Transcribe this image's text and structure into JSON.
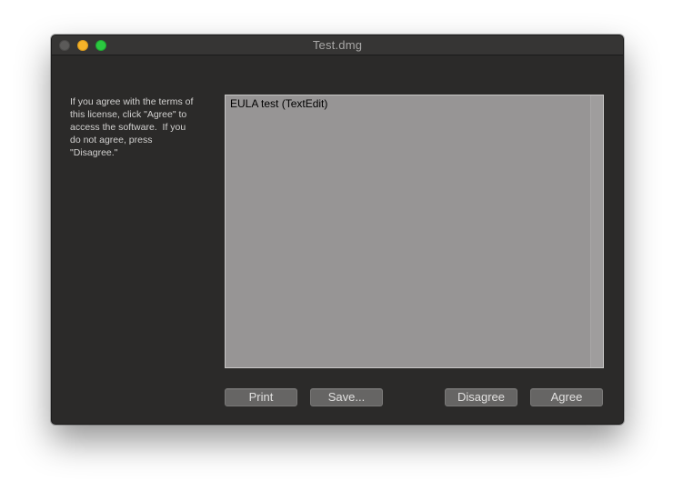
{
  "window": {
    "title": "Test.dmg"
  },
  "instructions": "If you agree with the terms of\nthis license, click \"Agree\" to\naccess the software.  If you\ndo not agree, press\n\"Disagree.\"",
  "license": {
    "text": "EULA test (TextEdit)"
  },
  "buttons": {
    "print": "Print",
    "save": "Save...",
    "disagree": "Disagree",
    "agree": "Agree"
  },
  "colors": {
    "window_background": "#2b2a29",
    "text_area_background": "#979595",
    "button_background": "#666564",
    "close_button": "#5b5a59",
    "minimize_button": "#f5b329",
    "zoom_button": "#2bc840"
  }
}
